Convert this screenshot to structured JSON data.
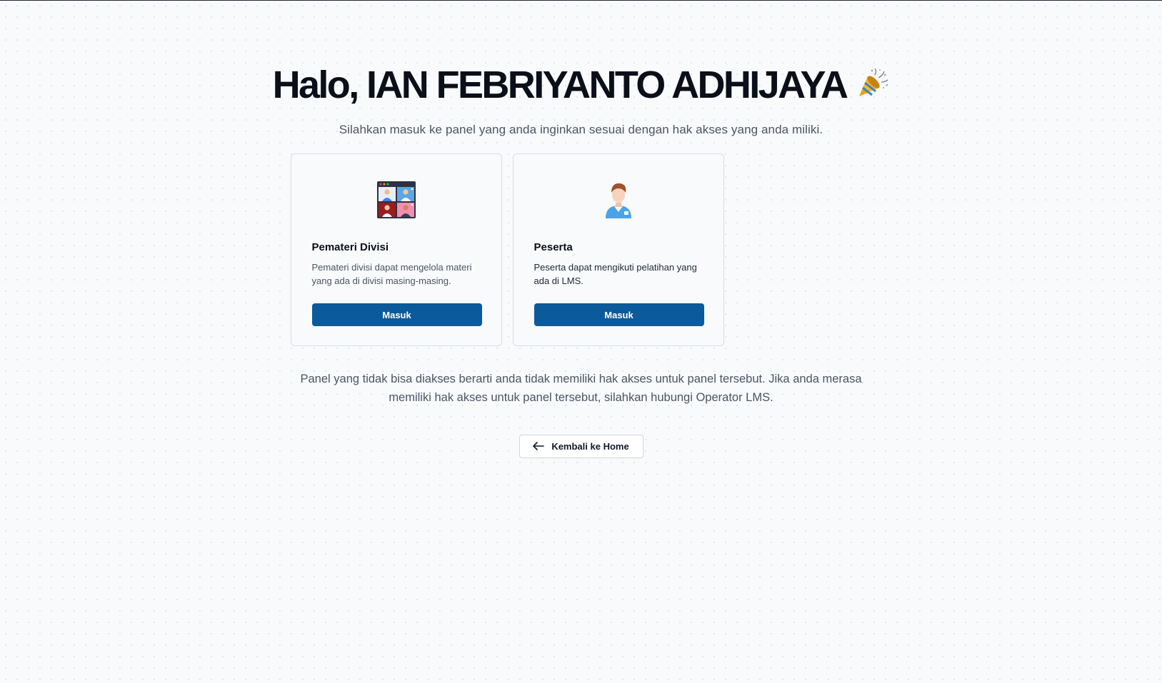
{
  "greeting": {
    "title": "Halo, IAN FEBRIYANTO ADHIJAYA",
    "icon": "party-popper-icon"
  },
  "subtitle": "Silahkan masuk ke panel yang anda inginkan sesuai dengan hak akses yang anda miliki.",
  "panels": [
    {
      "title": "Pemateri Divisi",
      "description": "Pemateri divisi dapat mengelola materi yang ada di divisi masing-masing.",
      "button_label": "Masuk",
      "icon": "video-conference-icon"
    },
    {
      "title": "Peserta",
      "description": "Peserta dapat mengikuti pelatihan yang ada di LMS.",
      "button_label": "Masuk",
      "icon": "participant-user-icon"
    }
  ],
  "notice": "Panel yang tidak bisa diakses berarti anda tidak memiliki hak akses untuk panel tersebut. Jika anda merasa memiliki hak akses untuk panel tersebut, silahkan hubungi Operator LMS.",
  "back_button": {
    "label": "Kembali ke Home",
    "icon": "arrow-left-icon"
  },
  "colors": {
    "primary": "#0b5a9c",
    "background": "#f8fafc",
    "text_muted": "#4b5563"
  }
}
